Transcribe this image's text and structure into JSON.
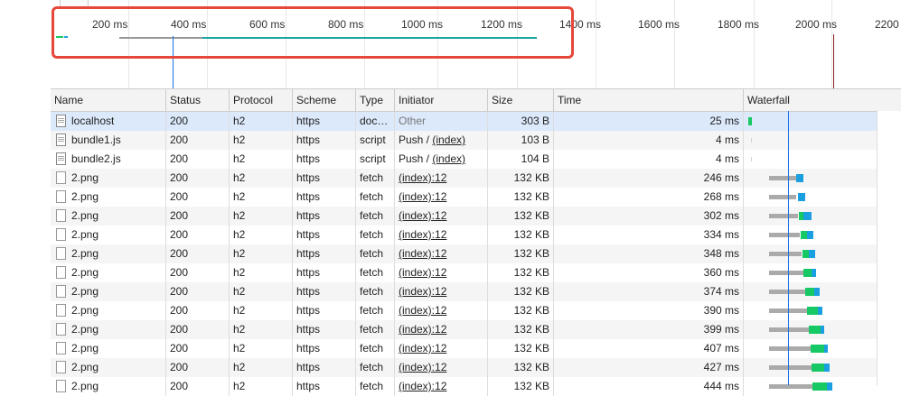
{
  "overview": {
    "ticks": [
      "200 ms",
      "400 ms",
      "600 ms",
      "800 ms",
      "1000 ms",
      "1200 ms",
      "1400 ms",
      "1600 ms",
      "1800 ms",
      "2000 ms",
      "2200"
    ]
  },
  "columns": {
    "name": "Name",
    "status": "Status",
    "protocol": "Protocol",
    "scheme": "Scheme",
    "type": "Type",
    "initiator": "Initiator",
    "size": "Size",
    "time": "Time",
    "waterfall": "Waterfall"
  },
  "rows": [
    {
      "name": "localhost",
      "status": "200",
      "protocol": "h2",
      "scheme": "https",
      "type": "doc…",
      "initiator": "Other",
      "size": "303 B",
      "time": "25 ms"
    },
    {
      "name": "bundle1.js",
      "status": "200",
      "protocol": "h2",
      "scheme": "https",
      "type": "script",
      "initiator_prefix": "Push / ",
      "initiator_link": "(index)",
      "size": "103 B",
      "time": "4 ms"
    },
    {
      "name": "bundle2.js",
      "status": "200",
      "protocol": "h2",
      "scheme": "https",
      "type": "script",
      "initiator_prefix": "Push / ",
      "initiator_link": "(index)",
      "size": "104 B",
      "time": "4 ms"
    },
    {
      "name": "2.png",
      "status": "200",
      "protocol": "h2",
      "scheme": "https",
      "type": "fetch",
      "initiator_link": "(index):12",
      "size": "132 KB",
      "time": "246 ms"
    },
    {
      "name": "2.png",
      "status": "200",
      "protocol": "h2",
      "scheme": "https",
      "type": "fetch",
      "initiator_link": "(index):12",
      "size": "132 KB",
      "time": "268 ms"
    },
    {
      "name": "2.png",
      "status": "200",
      "protocol": "h2",
      "scheme": "https",
      "type": "fetch",
      "initiator_link": "(index):12",
      "size": "132 KB",
      "time": "302 ms"
    },
    {
      "name": "2.png",
      "status": "200",
      "protocol": "h2",
      "scheme": "https",
      "type": "fetch",
      "initiator_link": "(index):12",
      "size": "132 KB",
      "time": "334 ms"
    },
    {
      "name": "2.png",
      "status": "200",
      "protocol": "h2",
      "scheme": "https",
      "type": "fetch",
      "initiator_link": "(index):12",
      "size": "132 KB",
      "time": "348 ms"
    },
    {
      "name": "2.png",
      "status": "200",
      "protocol": "h2",
      "scheme": "https",
      "type": "fetch",
      "initiator_link": "(index):12",
      "size": "132 KB",
      "time": "360 ms"
    },
    {
      "name": "2.png",
      "status": "200",
      "protocol": "h2",
      "scheme": "https",
      "type": "fetch",
      "initiator_link": "(index):12",
      "size": "132 KB",
      "time": "374 ms"
    },
    {
      "name": "2.png",
      "status": "200",
      "protocol": "h2",
      "scheme": "https",
      "type": "fetch",
      "initiator_link": "(index):12",
      "size": "132 KB",
      "time": "390 ms"
    },
    {
      "name": "2.png",
      "status": "200",
      "protocol": "h2",
      "scheme": "https",
      "type": "fetch",
      "initiator_link": "(index):12",
      "size": "132 KB",
      "time": "399 ms"
    },
    {
      "name": "2.png",
      "status": "200",
      "protocol": "h2",
      "scheme": "https",
      "type": "fetch",
      "initiator_link": "(index):12",
      "size": "132 KB",
      "time": "407 ms"
    },
    {
      "name": "2.png",
      "status": "200",
      "protocol": "h2",
      "scheme": "https",
      "type": "fetch",
      "initiator_link": "(index):12",
      "size": "132 KB",
      "time": "427 ms"
    },
    {
      "name": "2.png",
      "status": "200",
      "protocol": "h2",
      "scheme": "https",
      "type": "fetch",
      "initiator_link": "(index):12",
      "size": "132 KB",
      "time": "444 ms"
    }
  ],
  "colors": {
    "highlight": "#e5483b",
    "selected_row": "#dbe9fb",
    "waterfall_green": "#17c964",
    "waterfall_blue": "#1a9fe0",
    "waterfall_wait": "#aaaaaa",
    "timeline_marker": "#1a73e8"
  }
}
